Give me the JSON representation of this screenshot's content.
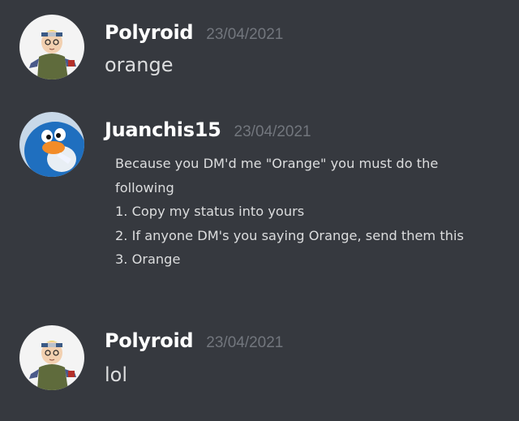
{
  "messages": [
    {
      "author": "Polyroid",
      "timestamp": "23/04/2021",
      "content": "orange",
      "avatar_icon": "ninja-character-avatar"
    },
    {
      "author": "Juanchis15",
      "timestamp": "23/04/2021",
      "content_lines": [
        "Because you DM'd me \"Orange\" you must do the",
        "following",
        "1. Copy my status into yours",
        "2. If anyone DM's you saying Orange, send them this",
        "3. Orange"
      ],
      "avatar_icon": "blue-penguin-avatar"
    },
    {
      "author": "Polyroid",
      "timestamp": "23/04/2021",
      "content": "lol",
      "avatar_icon": "ninja-character-avatar"
    }
  ],
  "colors": {
    "background": "#36393f",
    "username": "#ffffff",
    "timestamp": "#72767d",
    "text": "#dcddde",
    "penguin_blue": "#1f6fbf",
    "penguin_beak": "#f28c28"
  }
}
